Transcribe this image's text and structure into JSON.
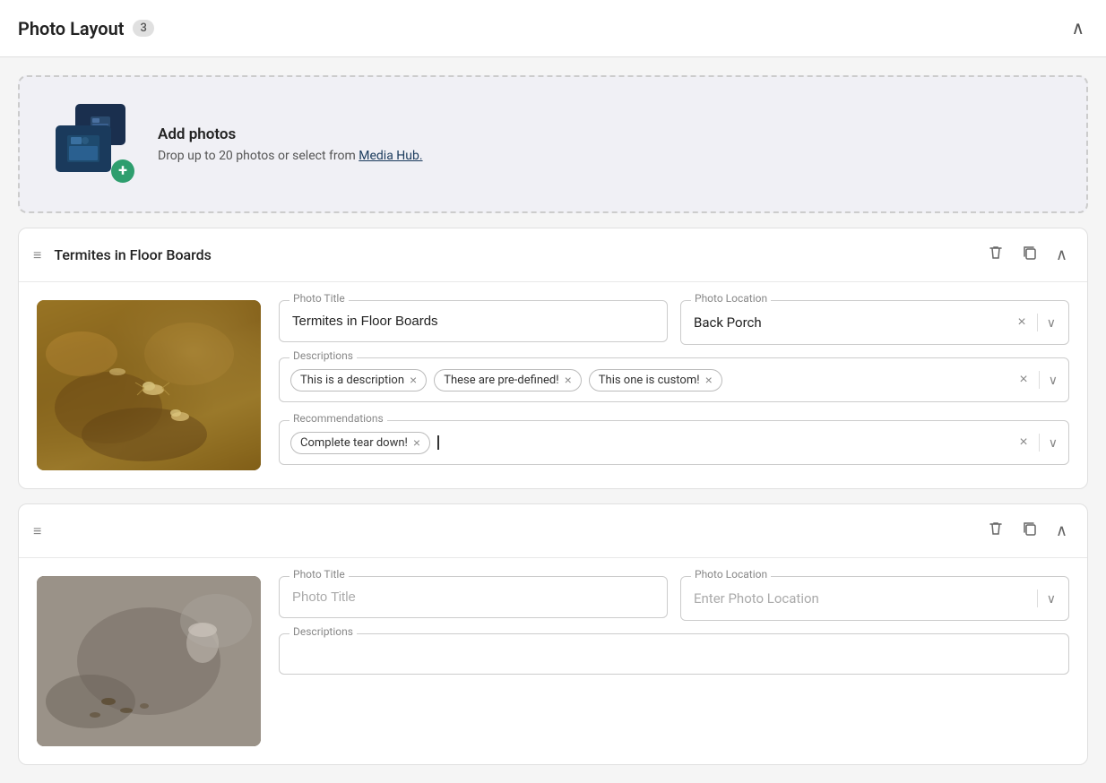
{
  "header": {
    "title": "Photo Layout",
    "badge": "3",
    "collapse_icon": "chevron-up"
  },
  "dropzone": {
    "title": "Add photos",
    "description": "Drop up to 20 photos or select from",
    "link_text": "Media Hub.",
    "plus_icon": "+"
  },
  "sections": [
    {
      "id": "section-1",
      "title": "Termites in Floor Boards",
      "photo_alt": "Termites in floor boards",
      "fields": {
        "photo_title_label": "Photo Title",
        "photo_title_value": "Termites in Floor Boards",
        "photo_location_label": "Photo Location",
        "photo_location_value": "Back Porch",
        "descriptions_label": "Descriptions",
        "descriptions_tags": [
          "This is a description",
          "These are pre-defined!",
          "This one is custom!"
        ],
        "recommendations_label": "Recommendations",
        "recommendations_tags": [
          "Complete tear down!"
        ]
      }
    },
    {
      "id": "section-2",
      "title": "",
      "photo_alt": "Termites on wall",
      "fields": {
        "photo_title_label": "Photo Title",
        "photo_title_placeholder": "Photo Title",
        "photo_title_value": "",
        "photo_location_label": "Photo Location",
        "photo_location_placeholder": "Enter Photo Location",
        "photo_location_value": "",
        "descriptions_label": "Descriptions",
        "descriptions_tags": []
      }
    }
  ],
  "icons": {
    "drag_handle": "≡",
    "delete": "🗑",
    "copy": "⧉",
    "chevron_up": "∧",
    "chevron_down": "∨",
    "close": "×"
  }
}
